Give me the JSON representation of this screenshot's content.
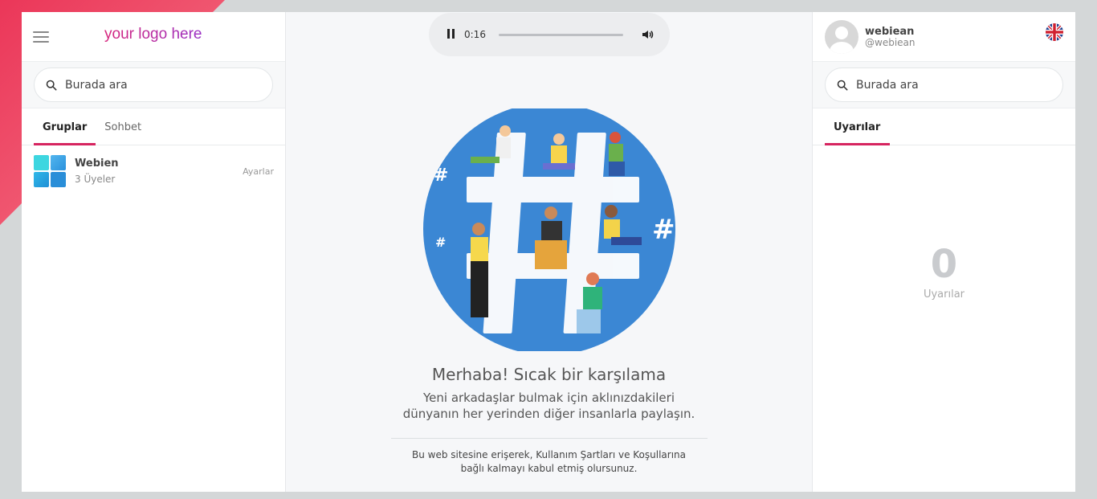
{
  "brand": {
    "logo_text": "your logo here"
  },
  "left_panel": {
    "search": {
      "placeholder": "Burada ara"
    },
    "tabs": [
      {
        "label": "Gruplar",
        "active": true
      },
      {
        "label": "Sohbet",
        "active": false
      }
    ],
    "groups": [
      {
        "name": "Webien",
        "meta": "3 Üyeler",
        "action": "Ayarlar"
      }
    ]
  },
  "player": {
    "time": "0:16",
    "progress": 0
  },
  "welcome": {
    "title": "Merhaba! Sıcak bir karşılama",
    "text_line1": "Yeni arkadaşlar bulmak için aklınızdakileri",
    "text_line2": "dünyanın her yerinden diğer insanlarla paylaşın.",
    "terms_line1": "Bu web sitesine erişerek, Kullanım Şartları ve Koşullarına",
    "terms_line2": "bağlı kalmayı kabul etmiş olursunuz."
  },
  "right_panel": {
    "user": {
      "name": "webiean",
      "handle": "@webiean"
    },
    "search": {
      "placeholder": "Burada ara"
    },
    "tabs": [
      {
        "label": "Uyarılar",
        "active": true
      }
    ],
    "alerts": {
      "count": "0",
      "label": "Uyarılar"
    }
  },
  "colors": {
    "accent": "#d6245f",
    "hero_blue": "#3b87d4",
    "background": "#d4d7d8"
  }
}
